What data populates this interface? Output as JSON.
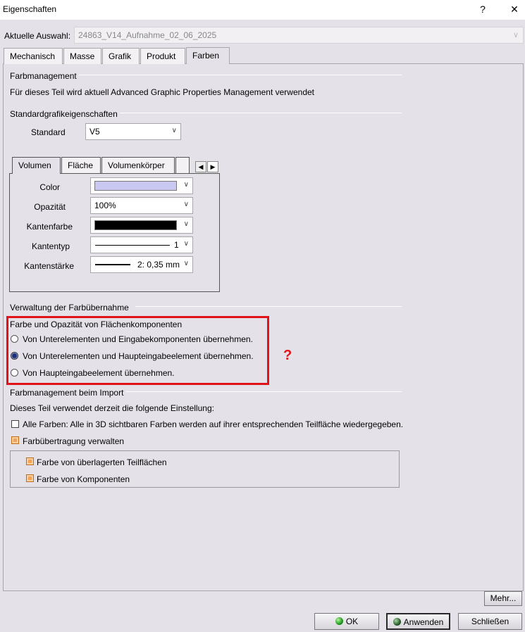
{
  "window": {
    "title": "Eigenschaften",
    "help_label": "?",
    "close_label": "✕"
  },
  "selection": {
    "label": "Aktuelle Auswahl:",
    "value": "24863_V14_Aufnahme_02_06_2025"
  },
  "tabs": [
    {
      "label": "Mechanisch",
      "active": false
    },
    {
      "label": "Masse",
      "active": false
    },
    {
      "label": "Grafik",
      "active": false
    },
    {
      "label": "Produkt",
      "active": false
    },
    {
      "label": "Farben",
      "active": true
    }
  ],
  "farbmanagement": {
    "title": "Farbmanagement",
    "text": "Für dieses Teil wird aktuell Advanced Graphic Properties Management verwendet"
  },
  "standard": {
    "title": "Standardgrafikeigenschaften",
    "label": "Standard",
    "value": "V5"
  },
  "subtabs": [
    {
      "label": "Volumen",
      "active": true
    },
    {
      "label": "Fläche",
      "active": false
    },
    {
      "label": "Volumenkörper",
      "active": false
    }
  ],
  "properties": {
    "color_label": "Color",
    "color_value": "#c8c8f0",
    "opacity_label": "Opazität",
    "opacity_value": "100%",
    "edge_color_label": "Kantenfarbe",
    "edge_color_value": "#000000",
    "edge_type_label": "Kantentyp",
    "edge_type_value": "1",
    "edge_width_label": "Kantenstärke",
    "edge_width_value": "2: 0,35 mm"
  },
  "verwaltung": {
    "title": "Verwaltung der Farbübernahme",
    "subtitle": "Farbe und Opazität von Flächenkomponenten",
    "options": [
      {
        "label": "Von Unterelementen und Eingabekomponenten übernehmen.",
        "selected": false
      },
      {
        "label": "Von Unterelementen und Haupteingabeelement übernehmen.",
        "selected": true
      },
      {
        "label": "Von Haupteingabeelement übernehmen.",
        "selected": false
      }
    ],
    "annotation": "?"
  },
  "import": {
    "title": "Farbmanagement beim Import",
    "text": "Dieses Teil verwendet derzeit die folgende Einstellung:",
    "all_colors_label": "Alle Farben: Alle in 3D sichtbaren Farben werden auf ihrer entsprechenden Teilfläche wiedergegeben.",
    "transfer_label": "Farbübertragung verwalten",
    "overlay_label": "Farbe von überlagerten Teilflächen",
    "components_label": "Farbe von Komponenten"
  },
  "buttons": {
    "more": "Mehr...",
    "ok": "OK",
    "apply": "Anwenden",
    "close": "Schließen"
  }
}
